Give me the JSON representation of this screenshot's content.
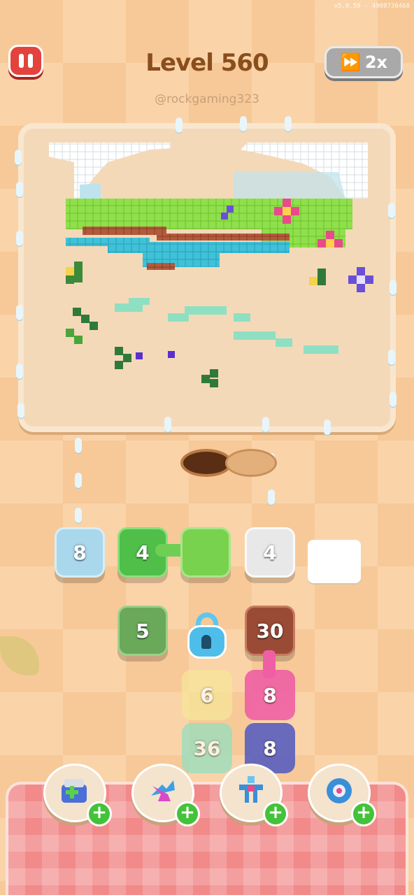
{
  "header": {
    "version": "v5.0.59 - 4908736468",
    "level_title": "Level 560",
    "username": "@rockgaming323",
    "speed_label": "2x"
  },
  "colors": {
    "pause": "#e2433d",
    "speed_button": "#a9a9a9",
    "tray": "#f28a8a",
    "booster_plus": "#44c23a"
  },
  "slots": [
    {
      "value": "8",
      "color": "#a9d7ec",
      "state": "filled"
    },
    {
      "value": "4",
      "color": "#4fbf4a",
      "state": "active"
    },
    {
      "value": "",
      "color": "#78d24e",
      "state": "filled"
    },
    {
      "value": "4",
      "color": "#e8e8e8",
      "state": "filled"
    },
    {
      "value": "",
      "color": "#ffffff",
      "state": "empty"
    }
  ],
  "queue_tiles": [
    {
      "value": "5",
      "color": "#6aa85a"
    },
    {
      "value": "30",
      "color": "#9a4b36"
    },
    {
      "value": "6",
      "color": "#f6e69a"
    },
    {
      "value": "8",
      "color": "#ef5fa4"
    },
    {
      "value": "36",
      "color": "#8fe0c2"
    },
    {
      "value": "8",
      "color": "#5a5fbf"
    }
  ],
  "locked_tile": {
    "icon": "lock-icon"
  },
  "boosters": [
    {
      "name": "add-slot",
      "icon": "box-plus-icon",
      "plus": "+"
    },
    {
      "name": "shuffle",
      "icon": "shuffle-arrows-icon",
      "plus": "+"
    },
    {
      "name": "magnet",
      "icon": "magnet-claw-icon",
      "plus": "+"
    },
    {
      "name": "rotate",
      "icon": "gear-screw-icon",
      "plus": "+"
    }
  ]
}
